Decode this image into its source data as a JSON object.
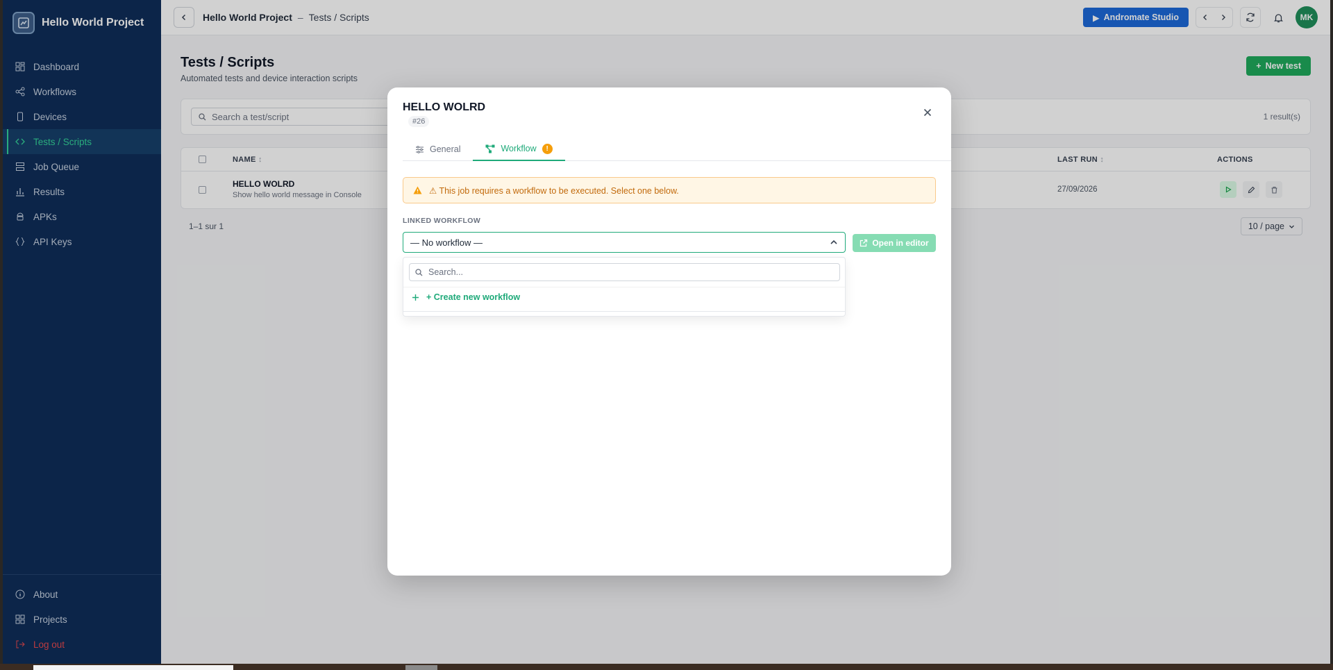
{
  "sidebar": {
    "brand": "Hello World Project",
    "items": [
      {
        "label": "Dashboard",
        "icon": "dashboard-icon"
      },
      {
        "label": "Workflows",
        "icon": "workflow-icon"
      },
      {
        "label": "Devices",
        "icon": "device-icon"
      },
      {
        "label": "Tests / Scripts",
        "icon": "code-icon",
        "active": true
      },
      {
        "label": "Job Queue",
        "icon": "queue-icon"
      },
      {
        "label": "Results",
        "icon": "chart-icon"
      },
      {
        "label": "APKs",
        "icon": "android-icon"
      },
      {
        "label": "API Keys",
        "icon": "braces-icon"
      }
    ],
    "bottom": [
      {
        "label": "About",
        "icon": "info-icon"
      },
      {
        "label": "Projects",
        "icon": "grid-icon"
      },
      {
        "label": "Log out",
        "icon": "logout-icon"
      }
    ]
  },
  "topbar": {
    "project": "Hello World Project",
    "separator": "–",
    "page": "Tests / Scripts",
    "studio_label": "Andromate Studio",
    "avatar": "MK"
  },
  "page": {
    "title": "Tests / Scripts",
    "subtitle": "Automated tests and device interaction scripts",
    "new_label": "New test",
    "search_placeholder": "Search a test/script",
    "result_count": "1 result(s)",
    "columns": {
      "name": "NAME",
      "last_run": "LAST RUN",
      "actions": "ACTIONS"
    },
    "rows": [
      {
        "name": "HELLO WOLRD",
        "description": "Show hello world message in Console",
        "last_run": "27/09/2026"
      }
    ],
    "pagination": "1–1 sur 1",
    "page_size": "10 / page"
  },
  "modal": {
    "title": "HELLO WOLRD",
    "id": "#26",
    "tabs": [
      {
        "label": "General"
      },
      {
        "label": "Workflow",
        "badge": "!"
      }
    ],
    "alert": "⚠ This job requires a workflow to be executed. Select one below.",
    "field_label": "LINKED WORKFLOW",
    "select_value": "— No workflow —",
    "open_editor": "Open in editor",
    "dropdown": {
      "search_placeholder": "Search...",
      "create_label": "+ Create new workflow"
    }
  },
  "colors": {
    "sidebar_bg": "#0f2e5a",
    "accent_green": "#1faa7a",
    "primary_blue": "#1d6ad9",
    "warning": "#f59e0b"
  }
}
